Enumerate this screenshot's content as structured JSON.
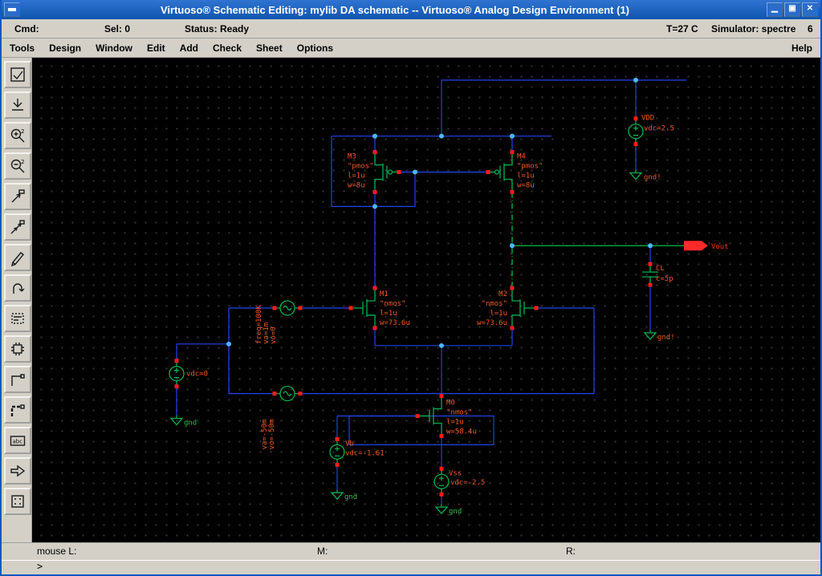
{
  "titlebar": {
    "title": "Virtuoso® Schematic Editing: mylib DA schematic -- Virtuoso® Analog Design Environment (1)"
  },
  "statusbar": {
    "cmd": "Cmd:",
    "sel": "Sel: 0",
    "status": "Status: Ready",
    "temp": "T=27 C",
    "simulator": "Simulator: spectre",
    "count": "6"
  },
  "menubar": {
    "items": [
      "Tools",
      "Design",
      "Window",
      "Edit",
      "Add",
      "Check",
      "Sheet",
      "Options"
    ],
    "help": "Help"
  },
  "toolbar": {
    "abc_label": "abc",
    "zoom_factor": "2"
  },
  "colors": {
    "wire": "#2244ee",
    "device": "#00b050",
    "label": "#f05a24",
    "pin": "#ff1a1a",
    "junction": "#4db8ff",
    "output_net": "#00bb44",
    "titlebar": "#1159c1"
  },
  "schematic": {
    "m3": {
      "name": "M3",
      "model": "\"pmos\"",
      "l": "l=1u",
      "w": "w=8u"
    },
    "m4": {
      "name": "M4",
      "model": "\"pmos\"",
      "l": "l=1u",
      "w": "w=8u"
    },
    "m1": {
      "name": "M1",
      "model": "\"nmos\"",
      "l": "l=1u",
      "w": "w=73.6u"
    },
    "m2": {
      "name": "M2",
      "model": "\"nmos\"",
      "l": "l=1u",
      "w": "w=73.6u"
    },
    "m0": {
      "name": "M0",
      "model": "\"nmos\"",
      "l": "l=1u",
      "w": "w=58.4u"
    },
    "vdd": {
      "name": "VDD",
      "value": "vdc=2.5",
      "gnd": "gnd!"
    },
    "vcm": {
      "value": "vdc=0",
      "gnd": "gnd"
    },
    "vin_p": {
      "l1": "freq=100K",
      "l2": "va=1m",
      "l3": "vo=0"
    },
    "vin_n": {
      "l1": "va=-50m",
      "l2": "vo=-50m"
    },
    "vb": {
      "name": "Vb",
      "value": "vdc=-1.61",
      "gnd": "gnd"
    },
    "vss": {
      "name": "Vss",
      "value": "vdc=-2.5",
      "gnd": "gnd"
    },
    "cl": {
      "name": "CL",
      "value": "c=5p",
      "gnd": "gnd!"
    },
    "vout": {
      "label": "Vout"
    }
  },
  "footer": {
    "mouse_l": "mouse L:",
    "mouse_m": "M:",
    "mouse_r": "R:",
    "prompt": ">"
  }
}
